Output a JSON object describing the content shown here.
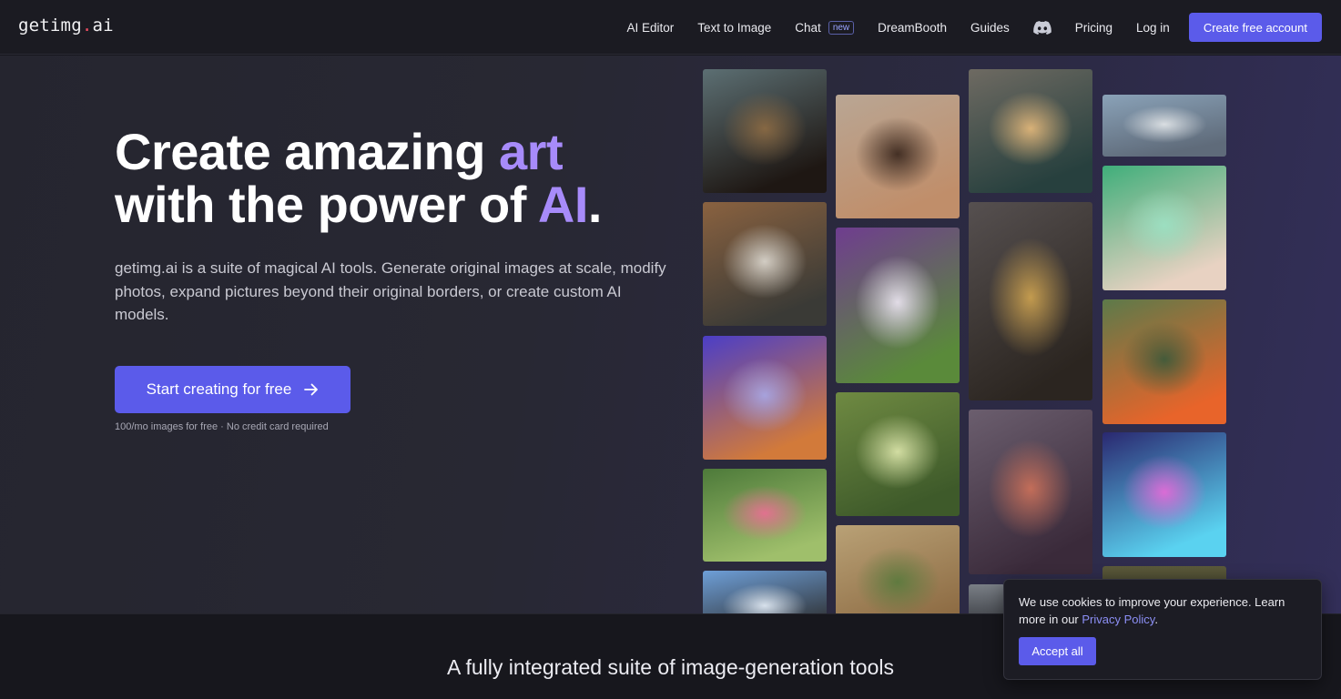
{
  "nav": {
    "logo_prefix": "getimg",
    "logo_dot": ".",
    "logo_suffix": "ai",
    "links": [
      "AI Editor",
      "Text to Image",
      "Chat",
      "DreamBooth",
      "Guides",
      "Pricing",
      "Log in"
    ],
    "chat_badge": "new",
    "discord_icon": "discord-icon",
    "cta": "Create free account"
  },
  "hero": {
    "title_line1_pre": "Create amazing ",
    "title_line1_accent": "art",
    "title_line2_pre": "with the power of ",
    "title_line2_accent": "AI",
    "title_line2_post": ".",
    "lead": "getimg.ai is a suite of magical AI tools. Generate original images at scale, modify photos, expand pictures beyond their original borders, or create custom AI models.",
    "button_label": "Start creating for free",
    "button_icon": "arrow-right-icon",
    "note": "100/mo images for free · No credit card required",
    "accent_color": "#a78bfa",
    "brand_color": "#5b5bea"
  },
  "gallery": [
    {
      "subject": "man-portrait",
      "colors": [
        "#5c6f73",
        "#8a6a44",
        "#1e1713"
      ]
    },
    {
      "subject": "bedroom",
      "colors": [
        "#8a6240",
        "#d9d4cb",
        "#3a3a36"
      ]
    },
    {
      "subject": "cat",
      "colors": [
        "#4b3ec7",
        "#a7a5e2",
        "#d27a3a"
      ]
    },
    {
      "subject": "roses",
      "colors": [
        "#4d7a3a",
        "#e66f92",
        "#9fbf6b"
      ]
    },
    {
      "subject": "horseman",
      "colors": [
        "#6e9fd8",
        "#dfe8f2",
        "#2d2d2d"
      ]
    },
    {
      "subject": "curly-man",
      "colors": [
        "#b9a694",
        "#3d2a20",
        "#c08e6a"
      ]
    },
    {
      "subject": "flower-woman",
      "colors": [
        "#6f3d8f",
        "#e8e2ee",
        "#5a8a3a"
      ]
    },
    {
      "subject": "tree-meadow",
      "colors": [
        "#6f8a42",
        "#d9e3a8",
        "#3e5a2a"
      ]
    },
    {
      "subject": "pyramid",
      "colors": [
        "#b9a176",
        "#5c7a3e",
        "#8c6a42"
      ]
    },
    {
      "subject": "stormy-sea",
      "colors": [
        "#6e6a62",
        "#e0b67a",
        "#27403e"
      ]
    },
    {
      "subject": "golden-skull",
      "colors": [
        "#565050",
        "#caa050",
        "#2b2520"
      ]
    },
    {
      "subject": "mushroom-forest",
      "colors": [
        "#6b5e6e",
        "#c9705a",
        "#3a2a3a"
      ]
    },
    {
      "subject": "clouds",
      "colors": [
        "#8aa2b8",
        "#dfe3e6",
        "#5f6b7a"
      ]
    },
    {
      "subject": "green-hair-girl",
      "colors": [
        "#3fae7a",
        "#9be0c2",
        "#e8d2c2"
      ]
    },
    {
      "subject": "koi-pond",
      "colors": [
        "#5c7a4a",
        "#3f5a3a",
        "#e8642a"
      ]
    },
    {
      "subject": "hamster",
      "colors": [
        "#2a2870",
        "#e26ad7",
        "#5ad2f0"
      ]
    }
  ],
  "section": {
    "title": "A fully integrated suite of image-generation tools"
  },
  "cookie": {
    "text_pre": "We use cookies to improve your experience. Learn more in our ",
    "link": "Privacy Policy",
    "text_post": ".",
    "button": "Accept all"
  }
}
